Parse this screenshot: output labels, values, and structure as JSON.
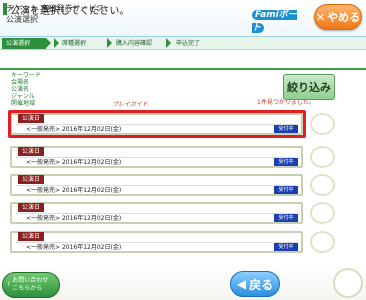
{
  "header": {
    "title_line1": "チケット 直接発券サービス",
    "title_line2": "公演選択",
    "logo": "Famiポート",
    "quit_label": "やめる"
  },
  "steps": [
    "公演選択",
    "席種選択",
    "購入内容確認",
    "申込完了"
  ],
  "instruction": "公演を選択してください。",
  "filters": {
    "labels": [
      "キーワード",
      "会場名",
      "公演名",
      "ジャンル",
      "開催地域"
    ],
    "filter_button": "絞り込み",
    "result_count": "1件見つかりました。",
    "play_guide": "プレイガイド"
  },
  "shows": [
    {
      "tag": "公演日",
      "text": "<一般発売> 2016年12月02日(金)",
      "button": "受付中"
    },
    {
      "tag": "公演日",
      "text": "<一般発売> 2016年12月02日(金)",
      "button": "受付中"
    },
    {
      "tag": "公演日",
      "text": "<一般発売> 2016年12月02日(金)",
      "button": "受付中"
    },
    {
      "tag": "公演日",
      "text": "<一般発売> 2016年12月02日(金)",
      "button": "受付中"
    },
    {
      "tag": "公演日",
      "text": "<一般発売> 2016年12月02日(金)",
      "button": "受付中"
    }
  ],
  "footer": {
    "help_label": "お問い合わせ\nこちらから",
    "back_label": "戻る"
  },
  "colors": {
    "accent_green": "#2f8f3e",
    "quit_orange": "#f07818",
    "highlight_red": "#e02020",
    "accept_blue": "#1a3fb0"
  }
}
